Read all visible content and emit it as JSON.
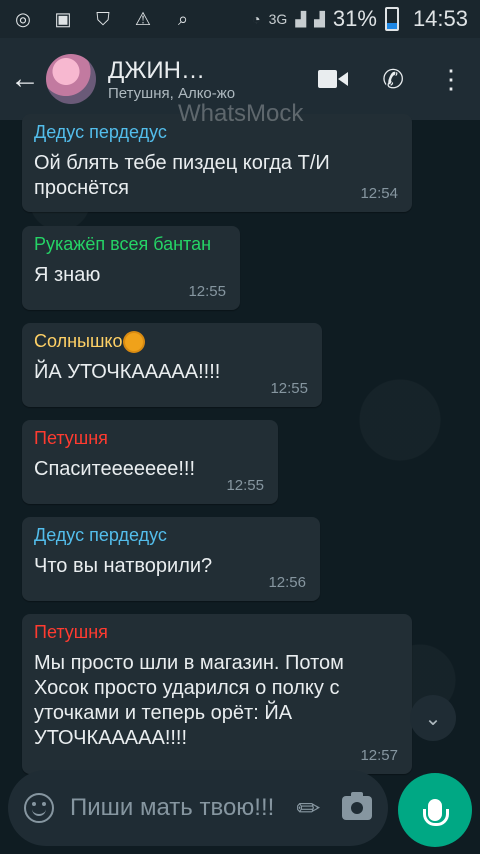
{
  "status_bar": {
    "network_label": "3G",
    "battery": "31%",
    "clock": "14:53"
  },
  "header": {
    "back_icon": "arrow-left-icon",
    "title": "ДЖИН…",
    "subtitle": "Петушня, Алко-жо",
    "icons": [
      "video-call-icon",
      "phone-icon",
      "more-vert-icon"
    ]
  },
  "watermark": "WhatsMock",
  "messages": [
    {
      "sender": "Дедус пердедус",
      "sender_color": "#53bdeb",
      "text": "Ой блять тебе пиздец когда Т/И проснётся",
      "time": "12:54"
    },
    {
      "sender": "Рукажёп всея бантан",
      "sender_color": "#25d366",
      "text": "Я знаю",
      "time": "12:55"
    },
    {
      "sender": "Солнышко",
      "sender_color": "#ffd166",
      "text": "ЙА УТОЧКААААА!!!!",
      "time": "12:55"
    },
    {
      "sender": "Петушня",
      "sender_color": "#ff3b30",
      "text": "Спаситеееееее!!!",
      "time": "12:55"
    },
    {
      "sender": "Дедус пердедус",
      "sender_color": "#53bdeb",
      "text": "Что вы натворили?",
      "time": "12:56"
    },
    {
      "sender": "Петушня",
      "sender_color": "#ff3b30",
      "text": "Мы просто шли в магазин. Потом Хосок просто ударился о полку с уточками и теперь орёт: ЙА УТОЧКААААА!!!!",
      "time": "12:57"
    }
  ],
  "input": {
    "placeholder": "Пиши мать твою!!!"
  },
  "colors": {
    "background": "#0f1c22",
    "header": "#1f2c34",
    "bubble": "#222e35",
    "accent": "#00a884"
  }
}
